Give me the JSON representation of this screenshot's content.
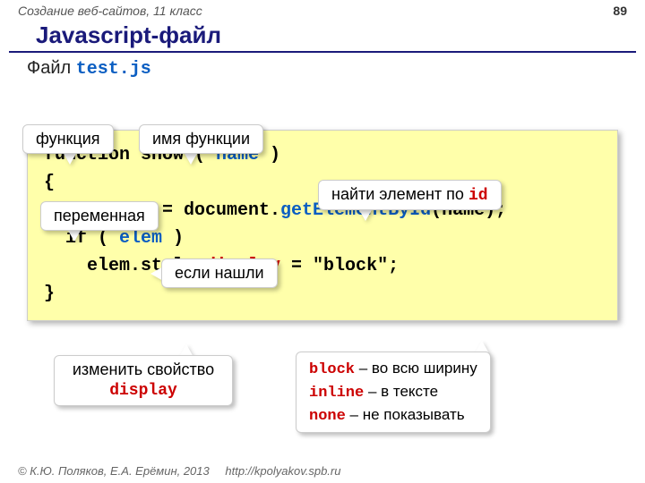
{
  "header": {
    "course": "Создание веб-сайтов, 11 класс",
    "page": "89"
  },
  "title": "Javascript-файл",
  "subtitle_prefix": "Файл ",
  "subtitle_filename": "test.js",
  "callouts": {
    "func": "функция",
    "funcname": "имя функции",
    "variable": "переменная",
    "find_prefix": "найти элемент по ",
    "find_id": "id",
    "if_found": "если нашли",
    "change_prefix": "изменить свойство",
    "change_prop": "display"
  },
  "code": {
    "l1a": "function show ( ",
    "l1b": "name",
    "l1c": " )",
    "l2": "{",
    "l3a": "  var elem = document.",
    "l3b": "getElementById",
    "l3c": "(name);",
    "l4a": "  if ( ",
    "l4b": "elem",
    "l4c": " ) ",
    "l5a": "    elem.style.",
    "l5b": "display",
    "l5c": " = \"block\";",
    "l6": "}"
  },
  "legend": {
    "r1a": "block",
    "r1b": " – во всю ширину",
    "r2a": "inline",
    "r2b": " – в тексте",
    "r3a": "none",
    "r3b": " – не показывать"
  },
  "footer": {
    "copyright": "© К.Ю. Поляков, Е.А. Ерёмин, 2013",
    "url": "http://kpolyakov.spb.ru"
  }
}
